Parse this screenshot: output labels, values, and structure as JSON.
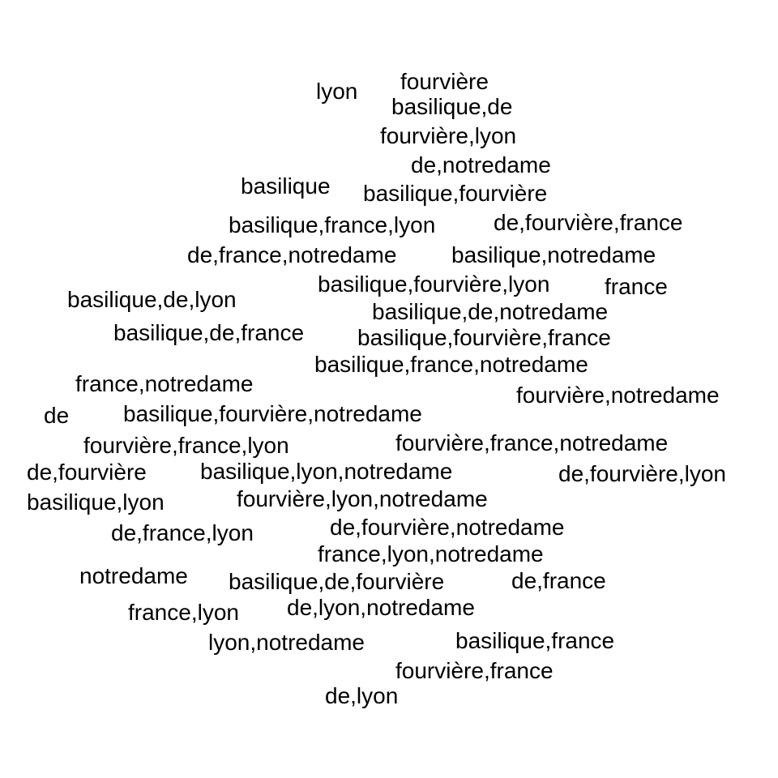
{
  "text_color": "#000000",
  "background_color": "#ffffff",
  "words": [
    "lyon",
    "fourvière",
    "basilique,de",
    "fourvière,lyon",
    "de,notredame",
    "basilique",
    "basilique,fourvière",
    "basilique,france,lyon",
    "de,fourvière,france",
    "de,france,notredame",
    "basilique,notredame",
    "basilique,fourvière,lyon",
    "france",
    "basilique,de,lyon",
    "basilique,de,notredame",
    "basilique,de,france",
    "basilique,fourvière,france",
    "basilique,france,notredame",
    "france,notredame",
    "fourvière,notredame",
    "de",
    "basilique,fourvière,notredame",
    "fourvière,france,lyon",
    "fourvière,france,notredame",
    "de,fourvière",
    "basilique,lyon,notredame",
    "de,fourvière,lyon",
    "basilique,lyon",
    "fourvière,lyon,notredame",
    "de,france,lyon",
    "de,fourvière,notredame",
    "france,lyon,notredame",
    "notredame",
    "basilique,de,fourvière",
    "de,france",
    "france,lyon",
    "de,lyon,notredame",
    "lyon,notredame",
    "basilique,france",
    "fourvière,france",
    "de,lyon"
  ]
}
